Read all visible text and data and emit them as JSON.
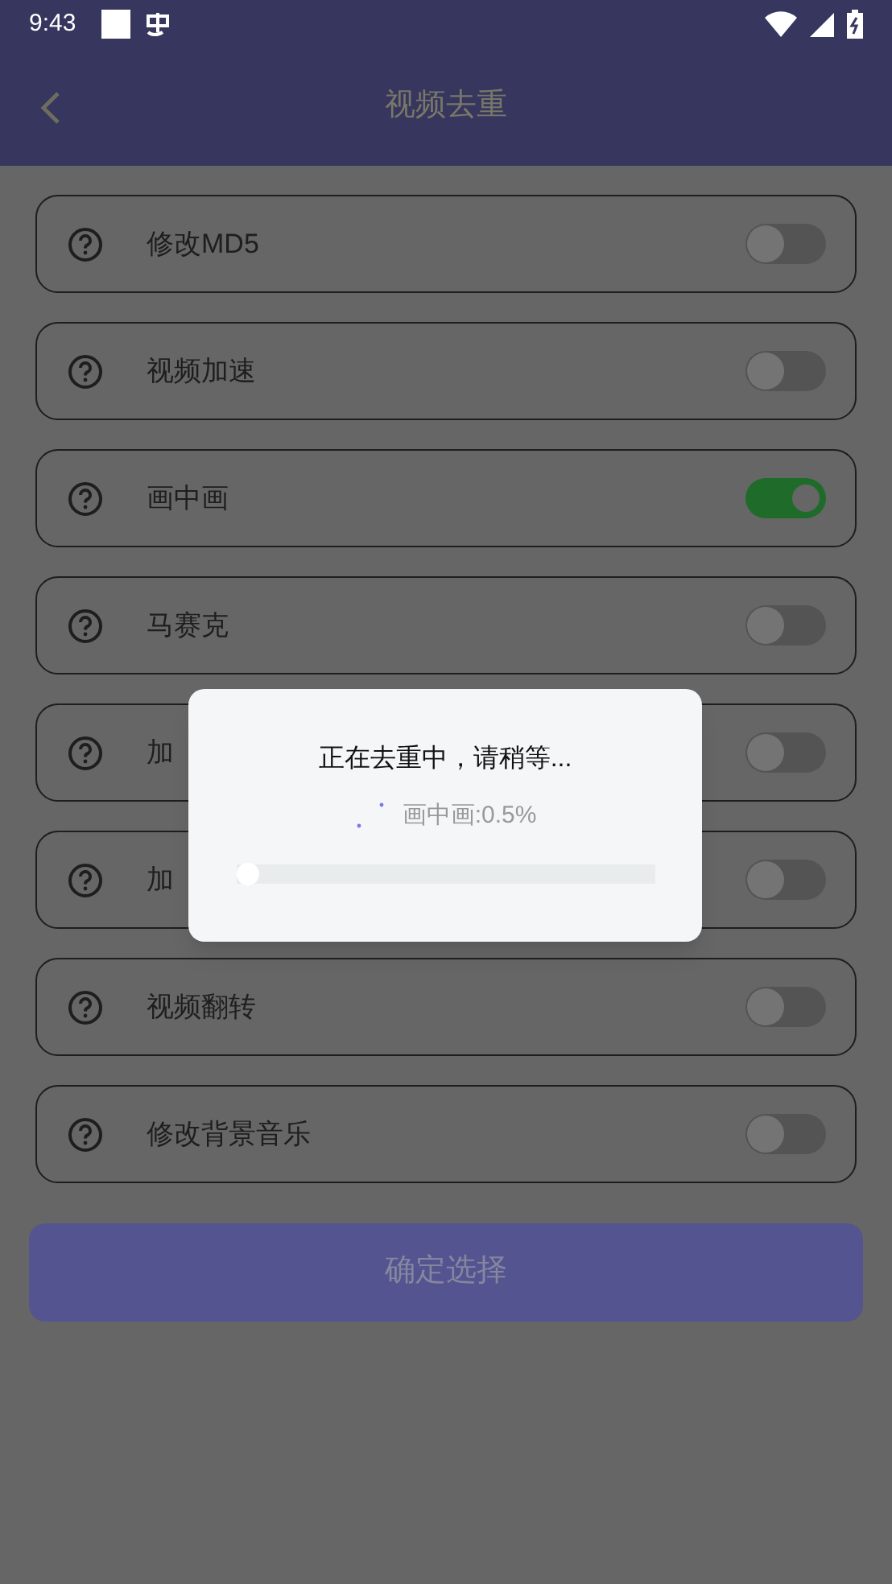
{
  "status_bar": {
    "time": "9:43"
  },
  "header": {
    "title": "视频去重"
  },
  "options": [
    {
      "label": "修改MD5",
      "on": false
    },
    {
      "label": "视频加速",
      "on": false
    },
    {
      "label": "画中画",
      "on": true
    },
    {
      "label": "马赛克",
      "on": false
    },
    {
      "label": "加",
      "on": false
    },
    {
      "label": "加",
      "on": false
    },
    {
      "label": "视频翻转",
      "on": false
    },
    {
      "label": "修改背景音乐",
      "on": false
    }
  ],
  "confirm_button": "确定选择",
  "dialog": {
    "message": "正在去重中，请稍等...",
    "status": "画中画:0.5%",
    "progress": {
      "level": 0.005
    }
  }
}
